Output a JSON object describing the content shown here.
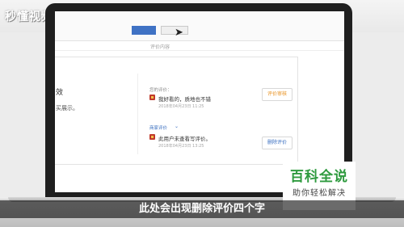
{
  "branding": {
    "logo_text": "秒懂视频",
    "watermark_title": "百科全说",
    "watermark_subtitle": "助你轻松解决"
  },
  "page": {
    "section_label": "评价内容",
    "left_title": "效",
    "left_subtitle": "买展示。"
  },
  "reviews": [
    {
      "label": "您的评价：",
      "text": "我好看的，质地也不错",
      "date": "2018年04月23日 11:25",
      "button_label": "评价审核"
    },
    {
      "label": "商家评价",
      "text": "此用户未查看写评价。",
      "date": "2018年04月23日 13:25",
      "button_label": "删除评价"
    }
  ],
  "subtitle": "此处会出现删除评价四个字",
  "colors": {
    "accent_orange": "#e8901d",
    "accent_blue": "#3a6fc0",
    "watermark_green": "#2e9a3e"
  }
}
